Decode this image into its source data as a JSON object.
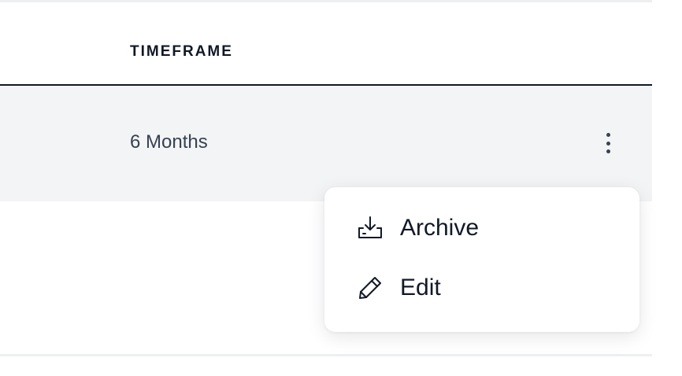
{
  "table": {
    "columns": [
      {
        "label": "TIMEFRAME"
      }
    ],
    "rows": [
      {
        "timeframe": "6 Months"
      }
    ]
  },
  "row_actions": {
    "icon": "more-vertical-icon"
  },
  "menu": {
    "items": [
      {
        "label": "Archive",
        "icon": "archive-download-icon"
      },
      {
        "label": "Edit",
        "icon": "pencil-icon"
      }
    ]
  },
  "colors": {
    "row_highlight": "#f3f4f6",
    "header_rule": "#111827",
    "text_primary": "#111827",
    "text_secondary": "#374151"
  }
}
